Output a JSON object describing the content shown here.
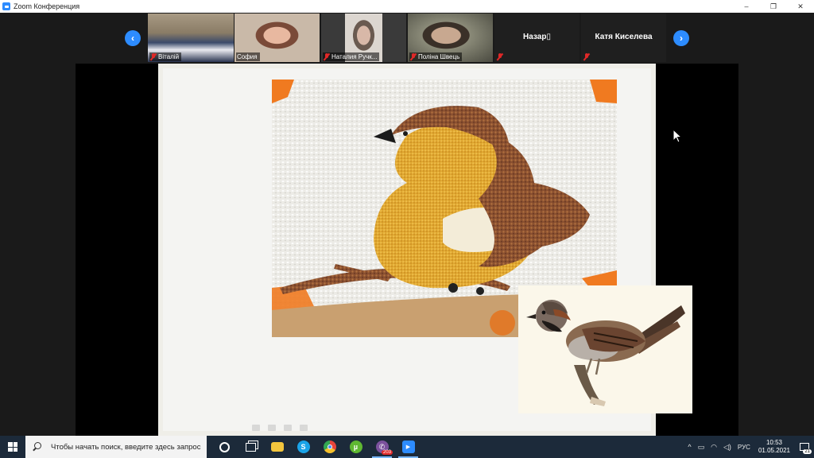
{
  "window": {
    "title": "Zoom Конференция",
    "controls": {
      "minimize": "–",
      "restore": "❐",
      "close": "✕"
    }
  },
  "participants": {
    "prev_label": "‹",
    "next_label": "›",
    "tiles": [
      {
        "name": "Віталій",
        "muted": true,
        "has_video": true
      },
      {
        "name": "София",
        "muted": false,
        "has_video": true
      },
      {
        "name": "Наталия Ручк...",
        "muted": true,
        "has_video": true
      },
      {
        "name": "Поліна Швець",
        "muted": true,
        "has_video": true
      },
      {
        "name": "Назар▯",
        "muted": true,
        "has_video": false
      },
      {
        "name": "Катя Киселева",
        "muted": true,
        "has_video": false
      }
    ]
  },
  "taskbar": {
    "search_placeholder": "Чтобы начать поиск, введите здесь запрос",
    "apps": [
      {
        "icon": "cortana-icon"
      },
      {
        "icon": "task-view-icon"
      },
      {
        "icon": "file-explorer-icon",
        "color": "#f2c53d"
      },
      {
        "icon": "skype-icon",
        "color": "#1aa3e8",
        "glyph": "S"
      },
      {
        "icon": "chrome-icon",
        "color": "#e8453c"
      },
      {
        "icon": "utorrent-icon",
        "color": "#5fb832",
        "glyph": "µ"
      },
      {
        "icon": "viber-icon",
        "color": "#7b519d",
        "glyph": "✆",
        "badge": "203"
      },
      {
        "icon": "zoom-icon",
        "color": "#2d8cff",
        "glyph": "▶"
      }
    ],
    "tray": {
      "chevron": "^",
      "language": "РУС",
      "time": "10:53",
      "date": "01.05.2021",
      "notifications": "21"
    }
  },
  "colors": {
    "zoom_blue": "#2d8cff",
    "mute_red": "#e02828",
    "taskbar_bg": "#1c2a3a"
  }
}
